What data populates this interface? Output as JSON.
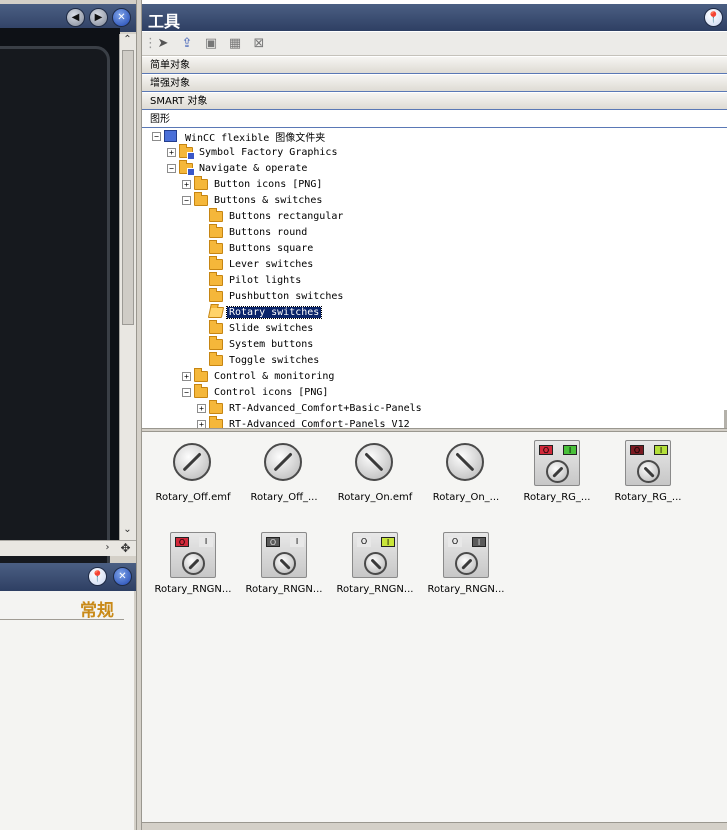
{
  "left_panel": {
    "general_tab": "常规"
  },
  "tools_panel": {
    "title": "工具",
    "categories": [
      {
        "label": "简单对象"
      },
      {
        "label": "增强对象"
      },
      {
        "label": "SMART 对象"
      },
      {
        "label": "图形"
      }
    ],
    "toolbar_icons": [
      "pointer-icon",
      "upload-icon",
      "folder-link-icon",
      "folder-grid-icon",
      "folder-x-icon"
    ]
  },
  "tree": {
    "items": [
      {
        "label": "WinCC flexible 图像文件夹",
        "level": 0,
        "toggle": "-",
        "icon": "computer-icon"
      },
      {
        "label": "Symbol Factory Graphics",
        "level": 1,
        "toggle": "+",
        "icon": "folder-link-icon"
      },
      {
        "label": "Navigate & operate",
        "level": 1,
        "toggle": "-",
        "icon": "folder-link-icon"
      },
      {
        "label": "Button icons [PNG]",
        "level": 2,
        "toggle": "+",
        "icon": "folder-icon"
      },
      {
        "label": "Buttons & switches",
        "level": 2,
        "toggle": "-",
        "icon": "folder-icon"
      },
      {
        "label": "Buttons rectangular",
        "level": 3,
        "toggle": "",
        "icon": "folder-icon"
      },
      {
        "label": "Buttons round",
        "level": 3,
        "toggle": "",
        "icon": "folder-icon"
      },
      {
        "label": "Buttons square",
        "level": 3,
        "toggle": "",
        "icon": "folder-icon"
      },
      {
        "label": "Lever switches",
        "level": 3,
        "toggle": "",
        "icon": "folder-icon"
      },
      {
        "label": "Pilot lights",
        "level": 3,
        "toggle": "",
        "icon": "folder-icon"
      },
      {
        "label": "Pushbutton switches",
        "level": 3,
        "toggle": "",
        "icon": "folder-icon"
      },
      {
        "label": "Rotary switches",
        "level": 3,
        "toggle": "",
        "icon": "folder-open-icon",
        "selected": true
      },
      {
        "label": "Slide switches",
        "level": 3,
        "toggle": "",
        "icon": "folder-icon"
      },
      {
        "label": "System buttons",
        "level": 3,
        "toggle": "",
        "icon": "folder-icon"
      },
      {
        "label": "Toggle switches",
        "level": 3,
        "toggle": "",
        "icon": "folder-icon"
      },
      {
        "label": "Control & monitoring",
        "level": 2,
        "toggle": "+",
        "icon": "folder-icon"
      },
      {
        "label": "Control icons [PNG]",
        "level": 2,
        "toggle": "-",
        "icon": "folder-icon"
      },
      {
        "label": "RT-Advanced_Comfort+Basic-Panels",
        "level": 3,
        "toggle": "+",
        "icon": "folder-icon"
      },
      {
        "label": "RT-Advanced_Comfort-Panels_V12",
        "level": 3,
        "toggle": "+",
        "icon": "folder-icon"
      }
    ]
  },
  "gallery": {
    "items": [
      {
        "name": "Rotary_Off.emf",
        "style": "knob-off"
      },
      {
        "name": "Rotary_Off_...",
        "style": "knob-off"
      },
      {
        "name": "Rotary_On.emf",
        "style": "knob-on"
      },
      {
        "name": "Rotary_On_...",
        "style": "knob-on"
      },
      {
        "name": "Rotary_RG_...",
        "style": "rg-off",
        "label_o": "O",
        "label_i": "I"
      },
      {
        "name": "Rotary_RG_...",
        "style": "rg-on",
        "label_o": "O",
        "label_i": "I"
      },
      {
        "name": "Rotary_RNGN...",
        "style": "rngn-red",
        "label_o": "O",
        "label_i": "I"
      },
      {
        "name": "Rotary_RNGN...",
        "style": "rngn-grey",
        "label_o": "O",
        "label_i": "I"
      },
      {
        "name": "Rotary_RNGN...",
        "style": "rngn-green",
        "label_o": "O",
        "label_i": "I"
      },
      {
        "name": "Rotary_RNGN...",
        "style": "rngn-grey2",
        "label_o": "O",
        "label_i": "I"
      }
    ]
  },
  "colors": {
    "title_bar": "#3b4d73",
    "selection": "#0a246a",
    "folder": "#f5b73a",
    "accent_gold": "#c98a18",
    "red_lamp": "#d2283a",
    "green_lamp": "#49c03a"
  }
}
